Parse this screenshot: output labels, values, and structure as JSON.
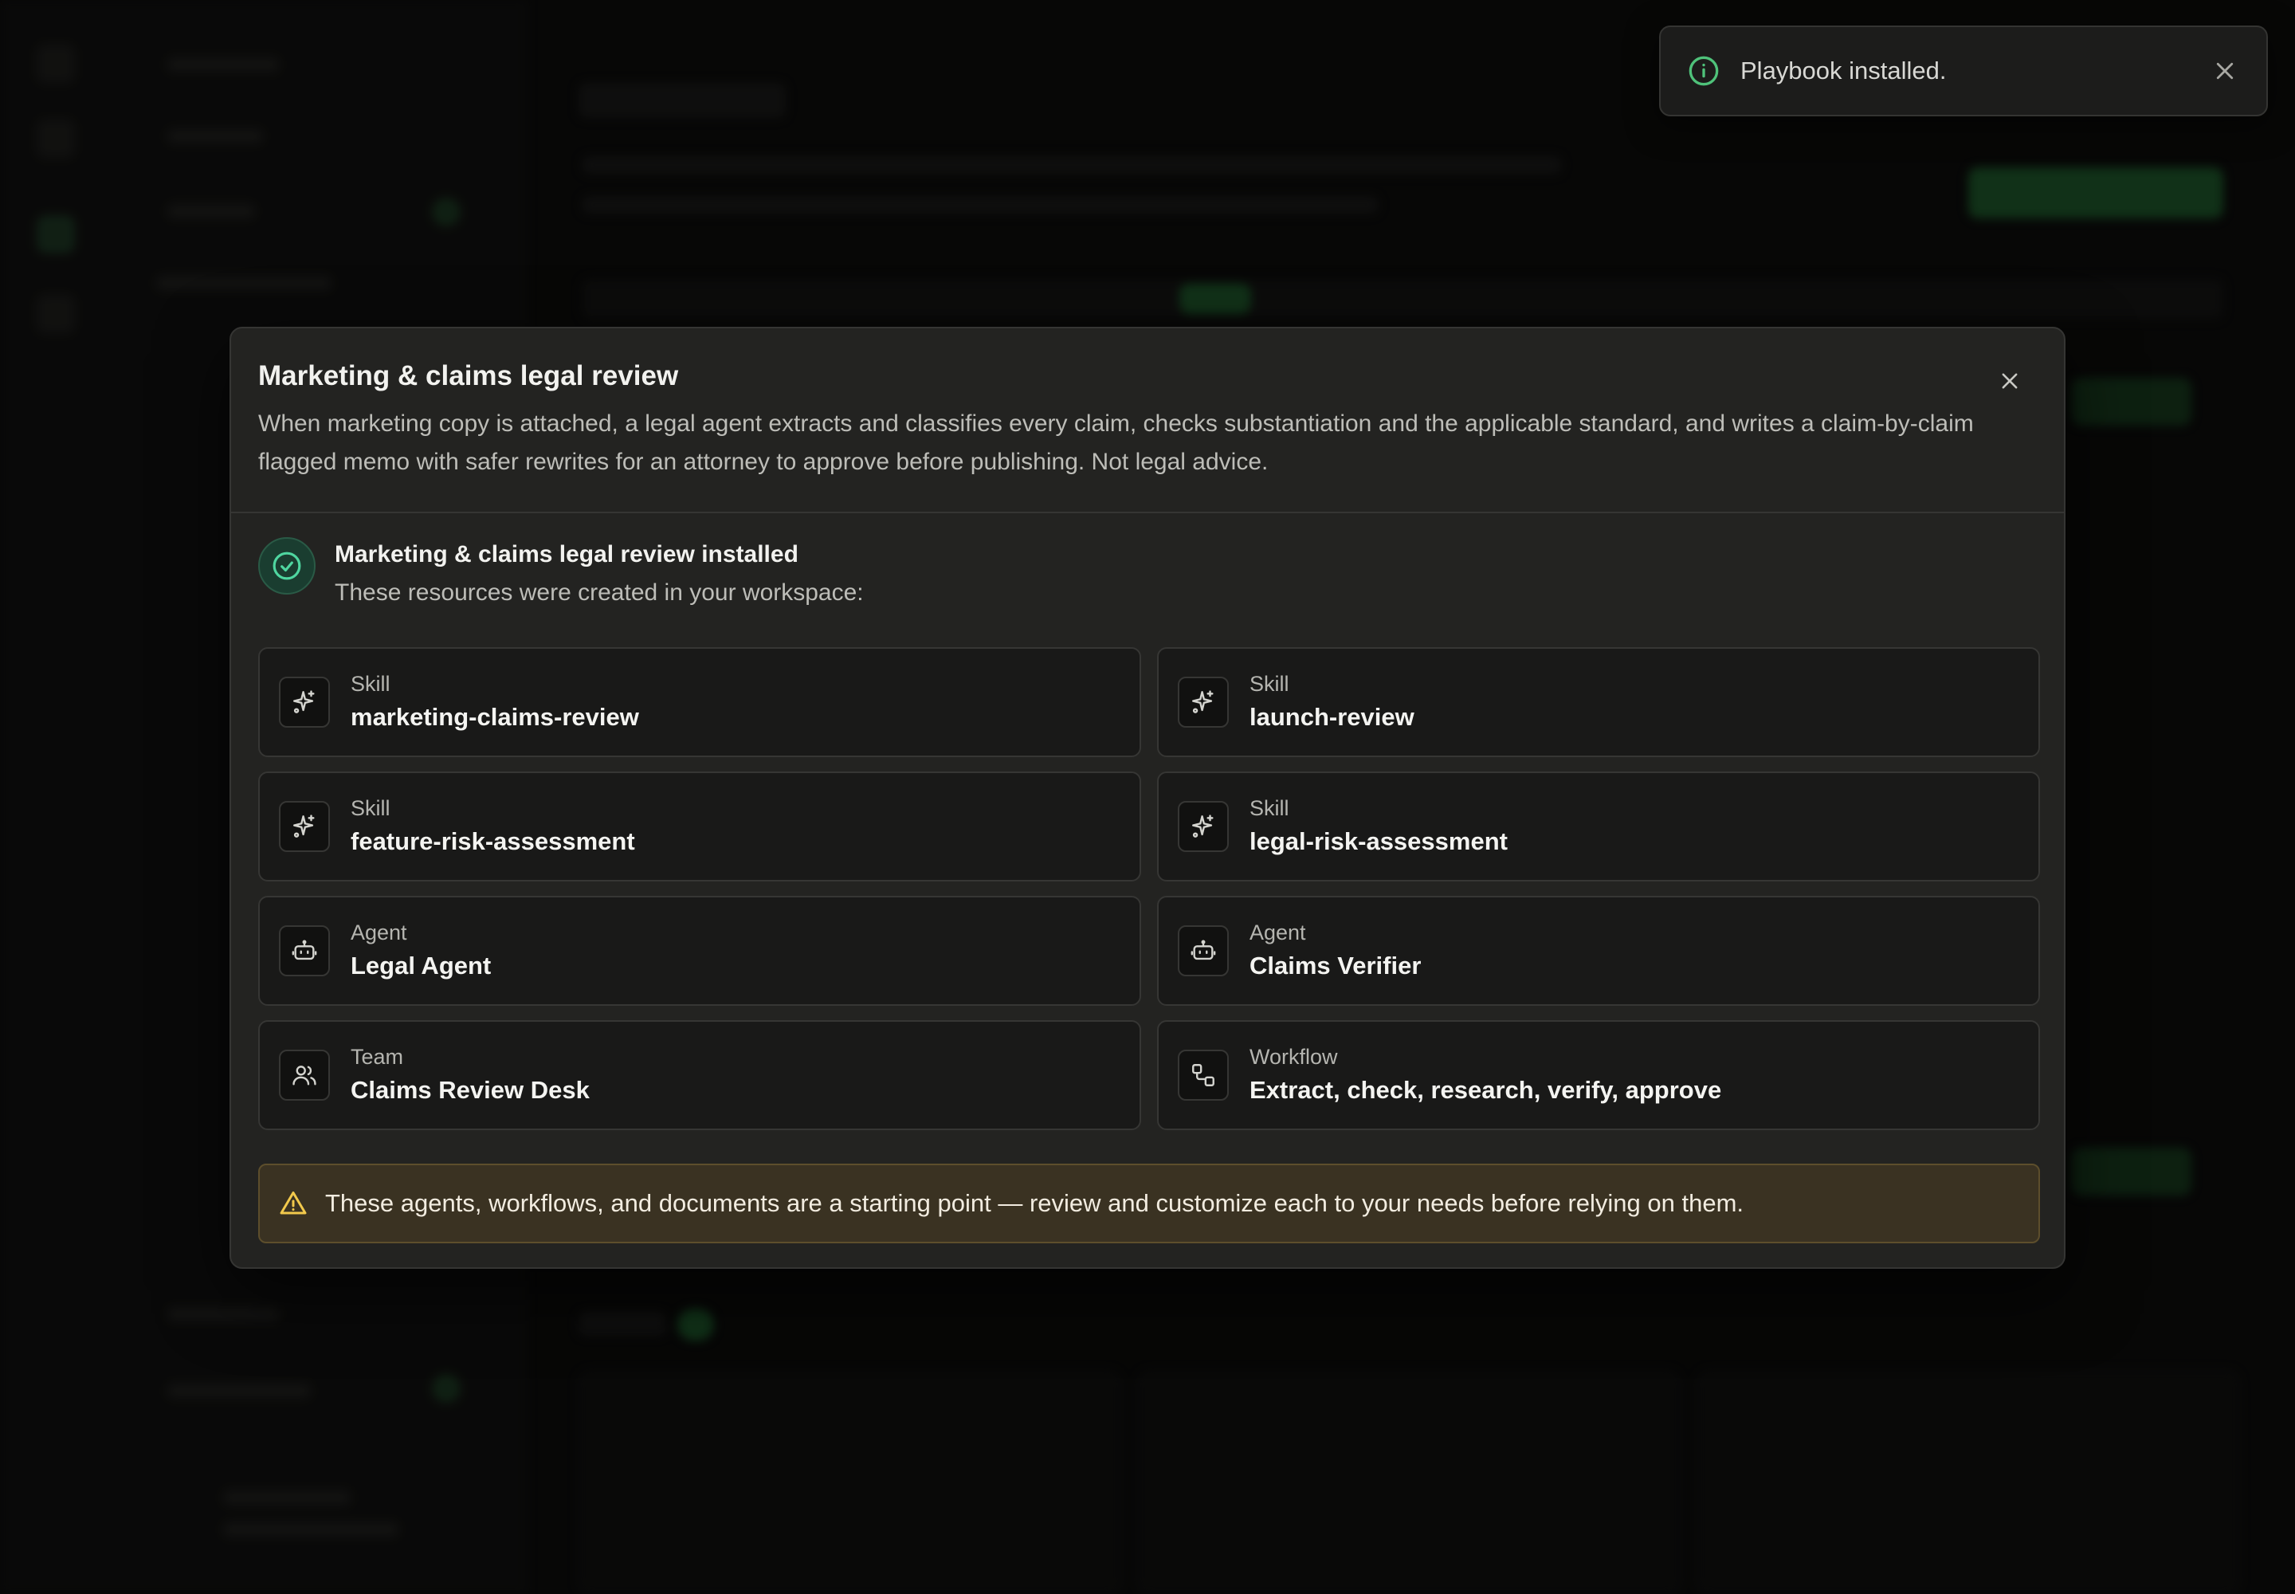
{
  "toast": {
    "message": "Playbook installed.",
    "icon": "info-circle-icon",
    "icon_color": "#4fc27a"
  },
  "modal": {
    "title": "Marketing & claims legal review",
    "description": "When marketing copy is attached, a legal agent extracts and classifies every claim, checks substantiation and the applicable standard, and writes a claim-by-claim flagged memo with safer rewrites for an attorney to approve before publishing. Not legal advice.",
    "success": {
      "title": "Marketing & claims legal review installed",
      "subtitle": "These resources were created in your workspace:",
      "icon_color": "#4fd6a0"
    },
    "resources": [
      {
        "type": "Skill",
        "name": "marketing-claims-review",
        "icon": "sparkles-icon"
      },
      {
        "type": "Skill",
        "name": "launch-review",
        "icon": "sparkles-icon"
      },
      {
        "type": "Skill",
        "name": "feature-risk-assessment",
        "icon": "sparkles-icon"
      },
      {
        "type": "Skill",
        "name": "legal-risk-assessment",
        "icon": "sparkles-icon"
      },
      {
        "type": "Agent",
        "name": "Legal Agent",
        "icon": "bot-icon"
      },
      {
        "type": "Agent",
        "name": "Claims Verifier",
        "icon": "bot-icon"
      },
      {
        "type": "Team",
        "name": "Claims Review Desk",
        "icon": "users-icon"
      },
      {
        "type": "Workflow",
        "name": "Extract, check, research, verify, approve",
        "icon": "workflow-icon"
      }
    ],
    "warning": {
      "text": "These agents, workflows, and documents are a starting point — review and customize each to your needs before relying on them.",
      "icon_color": "#f2c94c"
    }
  }
}
